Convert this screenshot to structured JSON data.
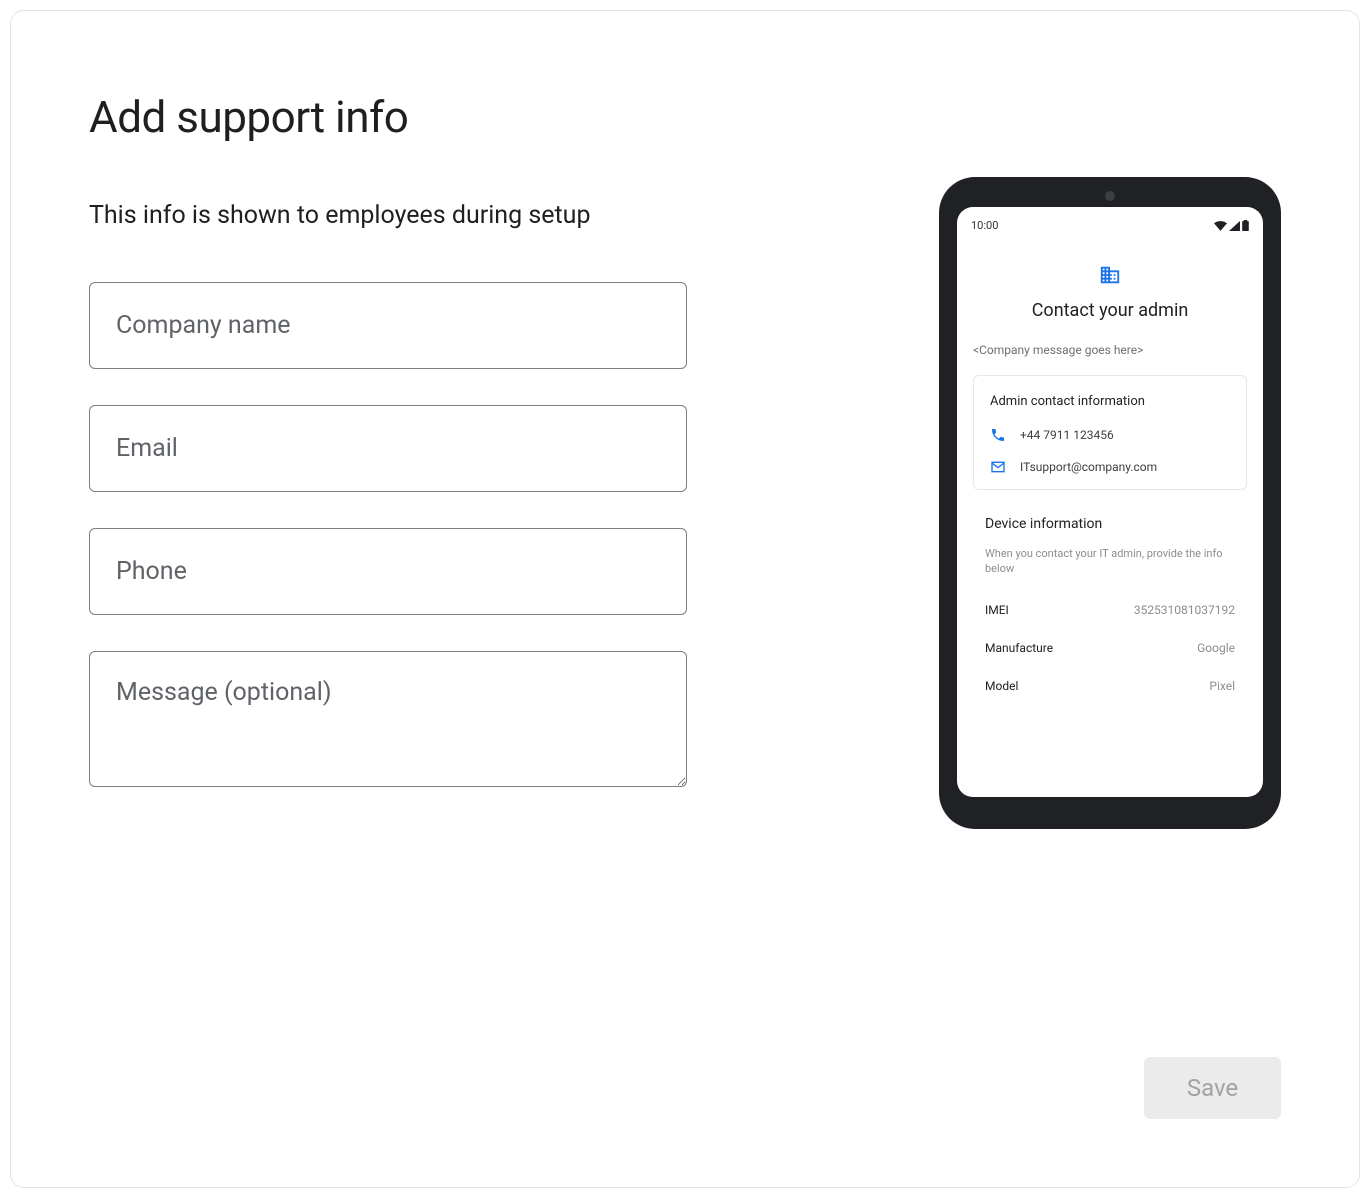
{
  "heading": "Add support info",
  "subheading": "This info is shown to employees during setup",
  "form": {
    "company_placeholder": "Company name",
    "email_placeholder": "Email",
    "phone_placeholder": "Phone",
    "message_placeholder": "Message (optional)"
  },
  "preview": {
    "clock": "10:00",
    "title": "Contact your admin",
    "company_message": "<Company message goes here>",
    "admin_section_title": "Admin contact information",
    "admin_phone": "+44 7911 123456",
    "admin_email": "ITsupport@company.com",
    "device_section_title": "Device information",
    "device_desc": "When you contact your IT admin, provide the info below",
    "imei_label": "IMEI",
    "imei_value": "352531081037192",
    "manufacture_label": "Manufacture",
    "manufacture_value": "Google",
    "model_label": "Model",
    "model_value": "Pixel"
  },
  "save_label": "Save"
}
